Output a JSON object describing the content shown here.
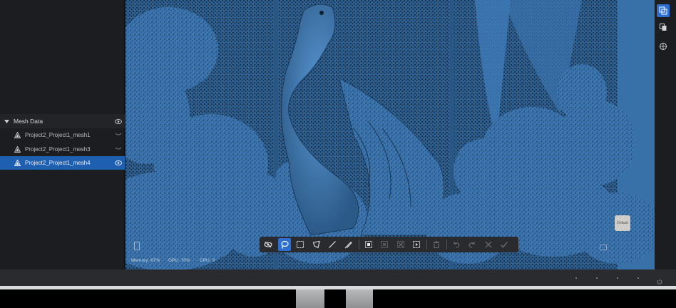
{
  "left_panel": {
    "section_title": "Mesh Data",
    "meshes": [
      {
        "label": "Project2_Project1_mesh1",
        "selected": false
      },
      {
        "label": "Project2_Project1_mesh3",
        "selected": false
      },
      {
        "label": "Project2_Project1_mesh4",
        "selected": true
      }
    ]
  },
  "viewport": {
    "stats": {
      "memory": "Memory: 67%",
      "gpu": "GPU: 70%",
      "cpu": "CPU: 3"
    },
    "nav_cube_label": "Default"
  },
  "toolbar": {
    "tools": [
      "visibility-toggle",
      "lasso-select",
      "rectangle-select",
      "polygon-select",
      "line-select",
      "brush-select",
      "invert-select",
      "deselect",
      "select-all",
      "select-connected",
      "delete",
      "undo",
      "redo",
      "cancel",
      "confirm"
    ],
    "active_tool": "lasso-select"
  },
  "right_bar": {
    "buttons": [
      "layers-icon",
      "copy-icon",
      "texture-icon"
    ],
    "active": "layers-icon"
  },
  "colors": {
    "accent": "#2c6fd1",
    "selection": "#1f5fb0",
    "mesh_blue": "#3d7ab7",
    "panel_bg": "#1c1d20"
  }
}
